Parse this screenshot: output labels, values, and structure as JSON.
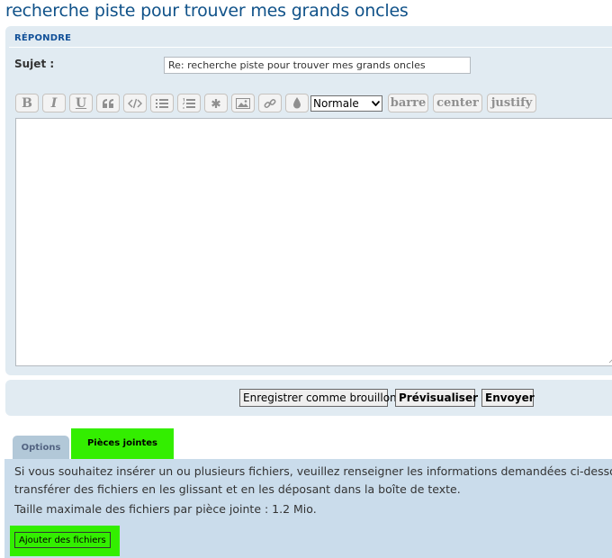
{
  "page": {
    "title": "recherche piste pour trouver mes grands oncles"
  },
  "reply": {
    "header": "RÉPONDRE",
    "subject_label": "Sujet :",
    "subject_value": "Re: recherche piste pour trouver mes grands oncles"
  },
  "toolbar": {
    "bold": "B",
    "italic": "I",
    "underline": "U",
    "font_size_selected": "Normale",
    "barre": "barre",
    "center": "center",
    "justify": "justify",
    "icons": [
      "bold-icon",
      "italic-icon",
      "underline-icon",
      "quote-icon",
      "code-icon",
      "list-icon",
      "numbered-list-icon",
      "list-item-icon",
      "image-icon",
      "link-icon",
      "color-drop-icon"
    ]
  },
  "actions": {
    "save_draft": "Enregistrer comme brouillon",
    "preview": "Prévisualiser",
    "submit": "Envoyer"
  },
  "tabs": {
    "options": "Options",
    "attachments": "Pièces jointes"
  },
  "attachments": {
    "info_line1": "Si vous souhaitez insérer un ou plusieurs fichiers, veuillez renseigner les informations demandées ci-dessous.",
    "info_line2": "transférer des fichiers en les glissant et en les déposant dans la boîte de texte.",
    "max_size": "Taille maximale des fichiers par pièce jointe : 1.2 Mio.",
    "add_button": "Ajouter des fichiers"
  },
  "colors": {
    "title": "#105289",
    "panel_bg": "#e1ebf2",
    "attach_bg": "#cadceb",
    "highlight": "#33ee00"
  }
}
